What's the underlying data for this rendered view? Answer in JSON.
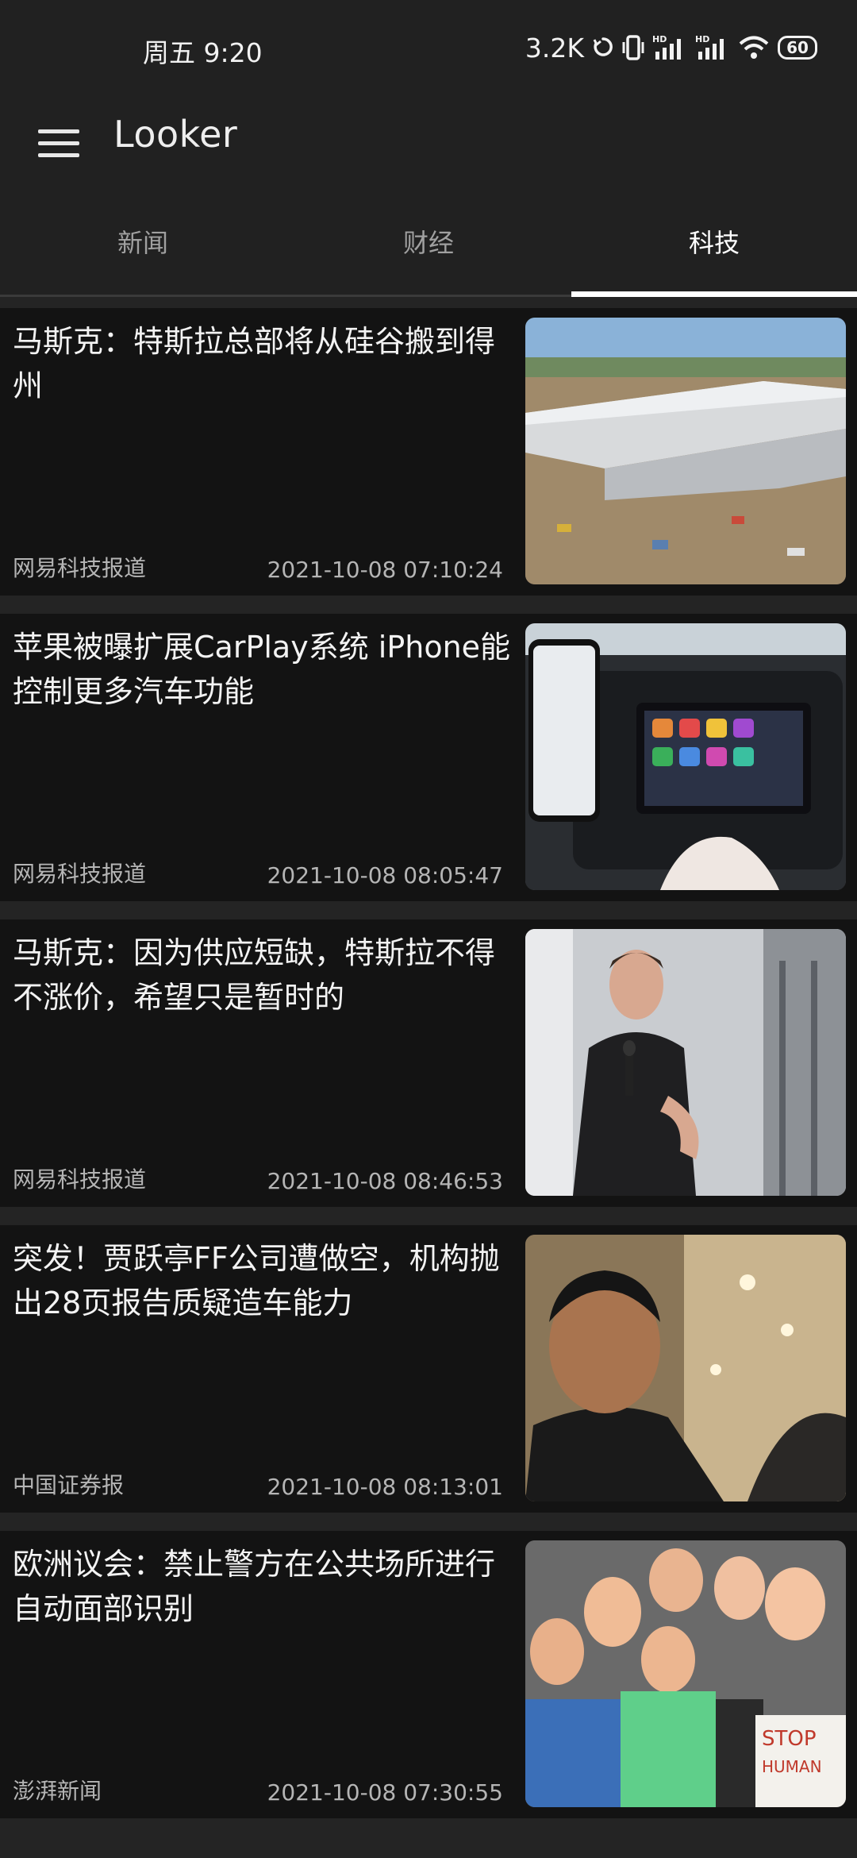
{
  "status_bar": {
    "time": "周五 9:20",
    "net_speed": "3.2K",
    "battery": "60",
    "icons": [
      "sync-icon",
      "vibrate-icon",
      "signal-hd-icon",
      "signal-hd-icon",
      "wifi-icon",
      "battery-icon"
    ]
  },
  "app_bar": {
    "title": "Looker",
    "menu_icon": "menu-icon"
  },
  "tabs": [
    {
      "label": "新闻",
      "active": false
    },
    {
      "label": "财经",
      "active": false
    },
    {
      "label": "科技",
      "active": true
    }
  ],
  "articles": [
    {
      "title": "马斯克：特斯拉总部将从硅谷搬到得州",
      "source": "网易科技报道",
      "time": "2021-10-08 07:10:24",
      "thumbnail": "factory-aerial-photo"
    },
    {
      "title": "苹果被曝扩展CarPlay系统 iPhone能控制更多汽车功能",
      "source": "网易科技报道",
      "time": "2021-10-08 08:05:47",
      "thumbnail": "carplay-dashboard-photo"
    },
    {
      "title": "马斯克：因为供应短缺，特斯拉不得不涨价，希望只是暂时的",
      "source": "网易科技报道",
      "time": "2021-10-08 08:46:53",
      "thumbnail": "speaker-with-microphone-photo"
    },
    {
      "title": "突发！贾跃亭FF公司遭做空，机构抛出28页报告质疑造车能力",
      "source": "中国证券报",
      "time": "2021-10-08 08:13:01",
      "thumbnail": "man-portrait-photo"
    },
    {
      "title": "欧洲议会：禁止警方在公共场所进行自动面部识别",
      "source": "澎湃新闻",
      "time": "2021-10-08 07:30:55",
      "thumbnail": "protest-masks-photo"
    }
  ],
  "colors": {
    "background": "#242424",
    "bar": "#212121",
    "card": "#131313",
    "text": "#f3f3f3",
    "muted": "#b5b5b5",
    "tab_indicator": "#ffffff"
  }
}
